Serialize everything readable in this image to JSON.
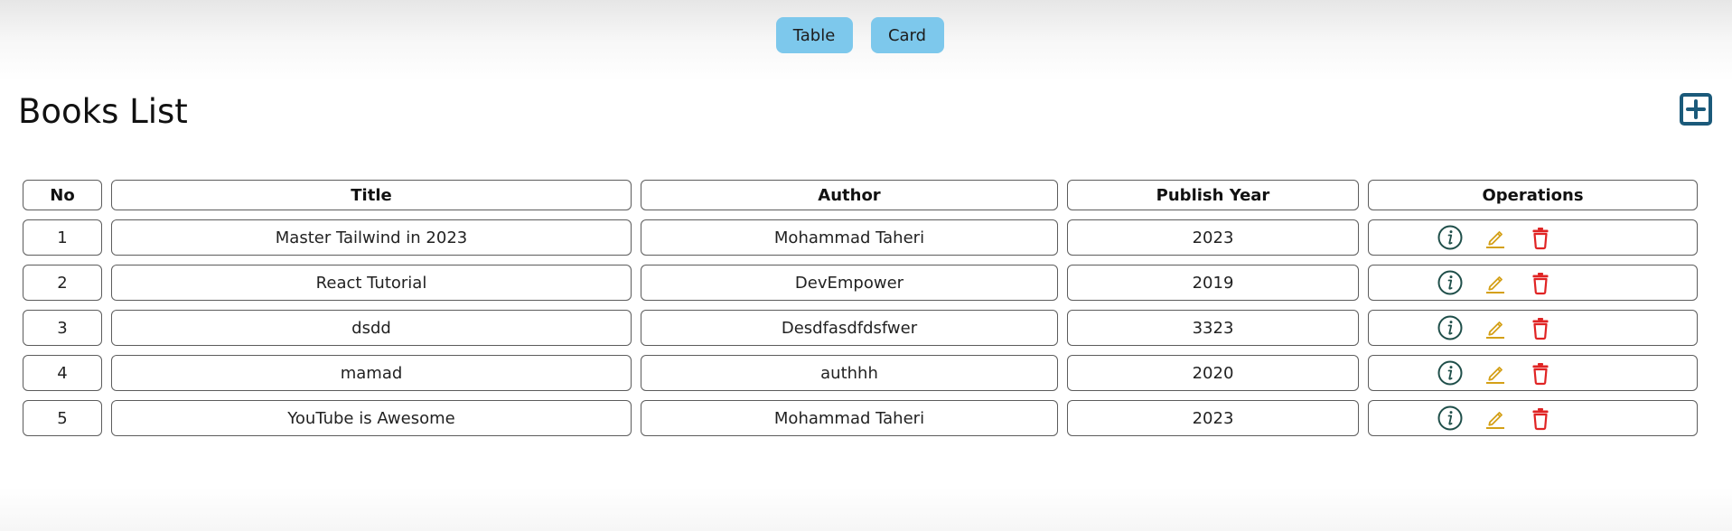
{
  "toggle": {
    "table_label": "Table",
    "card_label": "Card"
  },
  "header": {
    "title": "Books List",
    "add_icon": "plus-square-icon"
  },
  "table": {
    "columns": [
      "No",
      "Title",
      "Author",
      "Publish Year",
      "Operations"
    ],
    "rows": [
      {
        "no": "1",
        "title": "Master Tailwind in 2023",
        "author": "Mohammad Taheri",
        "year": "2023"
      },
      {
        "no": "2",
        "title": "React Tutorial",
        "author": "DevEmpower",
        "year": "2019"
      },
      {
        "no": "3",
        "title": "dsdd",
        "author": "Desdfasdfdsfwer",
        "year": "3323"
      },
      {
        "no": "4",
        "title": "mamad",
        "author": "authhh",
        "year": "2020"
      },
      {
        "no": "5",
        "title": "YouTube is Awesome",
        "author": "Mohammad Taheri",
        "year": "2023"
      }
    ],
    "operation_icons": [
      "info-icon",
      "edit-icon",
      "delete-icon"
    ]
  },
  "colors": {
    "toggle_bg": "#7dc8ec",
    "add_icon": "#1b5a7a",
    "info_icon": "#1f4f4a",
    "edit_icon": "#d4a017",
    "delete_icon": "#e02424",
    "cell_border": "#5c5c5c"
  }
}
